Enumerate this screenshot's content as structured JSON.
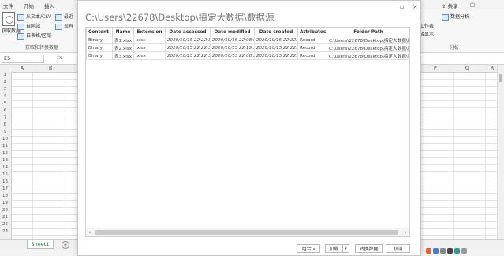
{
  "excel": {
    "ribbon_tabs": [
      "文件",
      "开始",
      "插入"
    ],
    "share_label": "共享",
    "ribbon_items": [
      "从文本/CSV",
      "自网站",
      "自表格/区域",
      "最近",
      "现有"
    ],
    "get_data_label": "获取数据",
    "group_label_get": "获取和转换数据",
    "right_items": [
      "数据分析",
      "预测工作表",
      "分级显示"
    ],
    "group_label_analysis": "分析",
    "name_box": "E5",
    "fx": "fx",
    "columns": [
      "A",
      "B",
      "P",
      "Q",
      "R"
    ],
    "rows": [
      "1",
      "2",
      "3",
      "4",
      "5",
      "6",
      "7",
      "8",
      "9",
      "10",
      "11",
      "12",
      "13",
      "14",
      "15",
      "16",
      "17",
      "18",
      "19",
      "20",
      "21",
      "22",
      "23"
    ],
    "sheet_tab": "Sheet1",
    "add_sheet": "+"
  },
  "dialog": {
    "title": "C:\\Users\\22678\\Desktop\\搞定大数据\\数据源",
    "columns": [
      "Content",
      "Name",
      "Extension",
      "Date accessed",
      "Date modified",
      "Date created",
      "Attributes",
      "Folder Path"
    ],
    "rows": [
      [
        "Binary",
        "表1.xlsx",
        ".xlsx",
        "2020/10/15 22:22:31",
        "2020/10/15 22:08:55",
        "2020/10/15 22:22:31",
        "Record",
        "C:\\Users\\22678\\Desktop\\搞定大数据\\数"
      ],
      [
        "Binary",
        "表2.xlsx",
        ".xlsx",
        "2020/10/15 22:22:31",
        "2020/10/15 22:19:18",
        "2020/10/15 22:22:31",
        "Record",
        "C:\\Users\\22678\\Desktop\\搞定大数据\\数"
      ],
      [
        "Binary",
        "表3.xlsx",
        ".xlsx",
        "2020/10/15 22:22:31",
        "2020/10/15 22:08:38",
        "2020/10/15 22:22:31",
        "Record",
        "C:\\Users\\22678\\Desktop\\搞定大数据\\数"
      ]
    ],
    "buttons": {
      "combine": "组合",
      "load": "加载",
      "transform": "转换数据",
      "cancel": "取消"
    },
    "window_controls": {
      "restore": "▫",
      "close": "×"
    }
  }
}
